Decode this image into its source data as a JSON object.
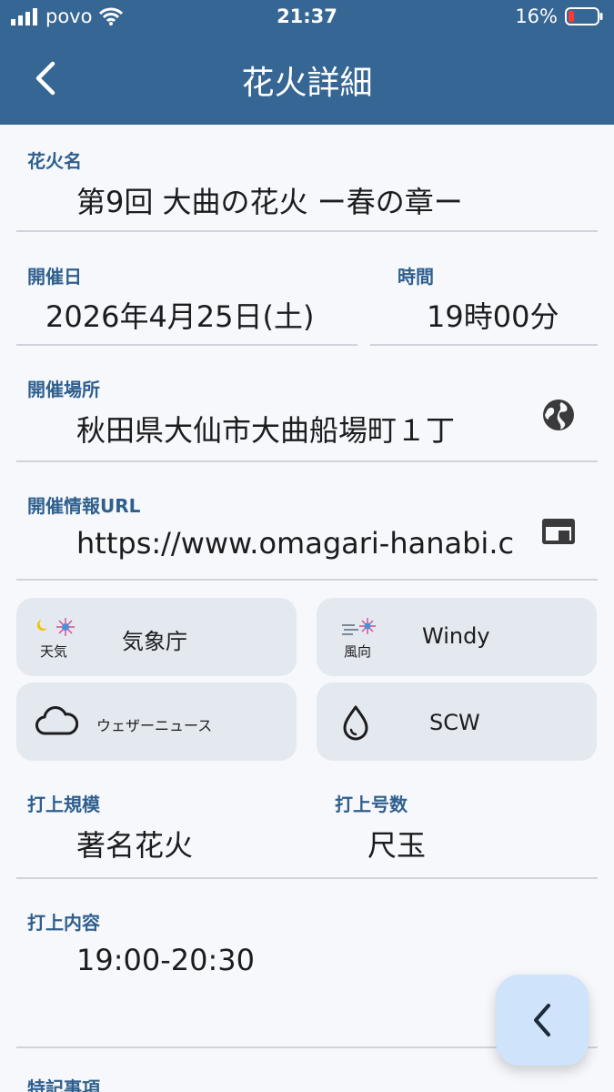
{
  "status_bar": {
    "carrier": "povo",
    "time": "21:37",
    "battery": "16%"
  },
  "header": {
    "title": "花火詳細"
  },
  "fields": {
    "name": {
      "label": "花火名",
      "value": "第9回 大曲の花火 ー春の章ー"
    },
    "date": {
      "label": "開催日",
      "value": "2026年4月25日(土)"
    },
    "time": {
      "label": "時間",
      "value": "19時00分"
    },
    "venue": {
      "label": "開催場所",
      "value": "秋田県大仙市大曲船場町１丁"
    },
    "url": {
      "label": "開催情報URL",
      "value": "https://www.omagari-hanabi.com"
    },
    "scale": {
      "label": "打上規模",
      "value": "著名花火"
    },
    "shell": {
      "label": "打上号数",
      "value": "尺玉"
    },
    "content": {
      "label": "打上内容",
      "value": "19:00-20:30"
    },
    "notes": {
      "label": "特記事項"
    }
  },
  "weather": {
    "jma": {
      "label": "気象庁",
      "icon_text": "天気"
    },
    "windy": {
      "label": "Windy",
      "icon_text": "風向"
    },
    "weathernews": {
      "label": "ウェザーニュース"
    },
    "scw": {
      "label": "SCW"
    }
  },
  "icons": {
    "back": "chevron-left-icon",
    "map": "globe-icon",
    "browser": "browser-window-icon",
    "cloud": "cloud-icon",
    "drop": "water-drop-icon",
    "fab": "chevron-left-icon"
  },
  "colors": {
    "header": "#366694",
    "label": "#2f5f8e",
    "tile": "#e4e9f0",
    "fab": "#cfe3fb"
  }
}
